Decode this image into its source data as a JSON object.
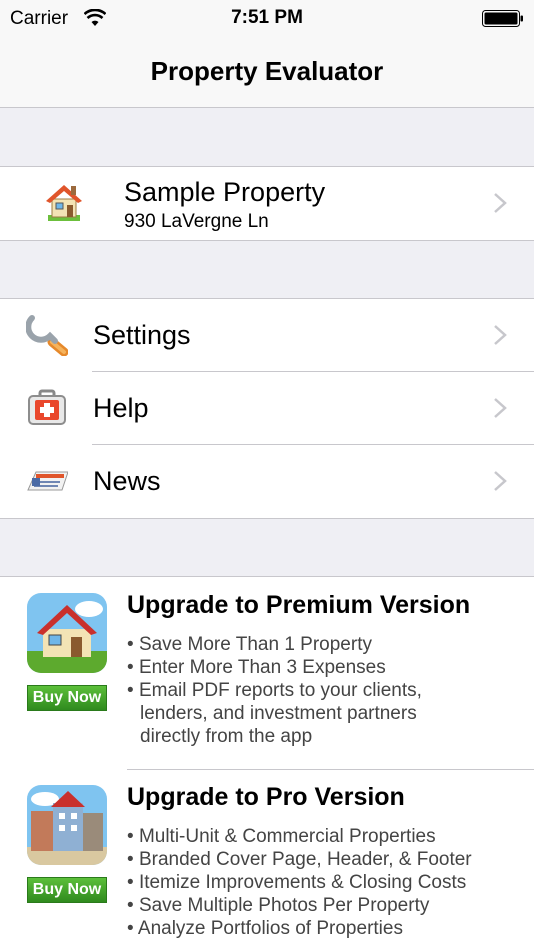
{
  "status": {
    "carrier": "Carrier",
    "time": "7:51 PM"
  },
  "nav": {
    "title": "Property Evaluator"
  },
  "property": {
    "name": "Sample Property",
    "address": "930 LaVergne Ln"
  },
  "menu": [
    {
      "label": "Settings",
      "icon": "wrench-icon"
    },
    {
      "label": "Help",
      "icon": "first-aid-kit-icon"
    },
    {
      "label": "News",
      "icon": "newspaper-icon"
    }
  ],
  "promos": [
    {
      "heading": "Upgrade to Premium Version",
      "buy_label": "Buy Now",
      "bullets": [
        "Save More Than 1 Property",
        "Enter More Than 3 Expenses",
        "Email PDF reports to your clients, lenders, and investment partners directly from the app"
      ]
    },
    {
      "heading": "Upgrade to Pro Version",
      "buy_label": "Buy Now",
      "bullets": [
        "Multi-Unit & Commercial Properties",
        "Branded Cover Page, Header, & Footer",
        "Itemize Improvements & Closing Costs",
        "Save Multiple Photos Per Property",
        "Analyze Portfolios of Properties"
      ]
    }
  ]
}
